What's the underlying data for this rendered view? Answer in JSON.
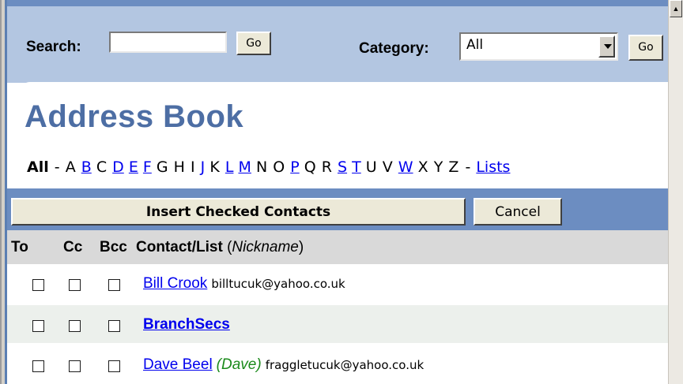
{
  "search": {
    "label": "Search:",
    "value": "",
    "go_label": "Go"
  },
  "category": {
    "label": "Category:",
    "selected": "All",
    "go_label": "Go"
  },
  "title": "Address Book",
  "alphabet": {
    "all": "All",
    "letters": [
      {
        "t": "A",
        "link": false
      },
      {
        "t": "B",
        "link": true
      },
      {
        "t": "C",
        "link": false
      },
      {
        "t": "D",
        "link": true
      },
      {
        "t": "E",
        "link": true
      },
      {
        "t": "F",
        "link": true
      },
      {
        "t": "G",
        "link": false
      },
      {
        "t": "H",
        "link": false
      },
      {
        "t": "I",
        "link": false
      },
      {
        "t": "J",
        "link": true
      },
      {
        "t": "K",
        "link": false
      },
      {
        "t": "L",
        "link": true
      },
      {
        "t": "M",
        "link": true
      },
      {
        "t": "N",
        "link": false
      },
      {
        "t": "O",
        "link": false
      },
      {
        "t": "P",
        "link": true
      },
      {
        "t": "Q",
        "link": false
      },
      {
        "t": "R",
        "link": false
      },
      {
        "t": "S",
        "link": true
      },
      {
        "t": "T",
        "link": true
      },
      {
        "t": "U",
        "link": false
      },
      {
        "t": "V",
        "link": false
      },
      {
        "t": "W",
        "link": true
      },
      {
        "t": "X",
        "link": false
      },
      {
        "t": "Y",
        "link": false
      },
      {
        "t": "Z",
        "link": false
      }
    ],
    "lists": "Lists"
  },
  "actions": {
    "insert_label": "Insert Checked Contacts",
    "cancel_label": "Cancel"
  },
  "columns": {
    "to": "To",
    "cc": "Cc",
    "bcc": "Bcc",
    "contact": "Contact/List",
    "nickname": "Nickname"
  },
  "contacts": [
    {
      "name": "Bill Crook",
      "nickname": "",
      "email": "billtucuk@yahoo.co.uk",
      "is_list": false
    },
    {
      "name": "BranchSecs",
      "nickname": "",
      "email": "",
      "is_list": true
    },
    {
      "name": "Dave Beel",
      "nickname": "(Dave)",
      "email": "fraggletucuk@yahoo.co.uk",
      "is_list": false
    }
  ],
  "colors": {
    "header_bg": "#b3c6e1",
    "bar_bg": "#6c8dc1",
    "title": "#4d6ea4",
    "link": "#0000ee",
    "nickname": "#1b8a1b"
  }
}
